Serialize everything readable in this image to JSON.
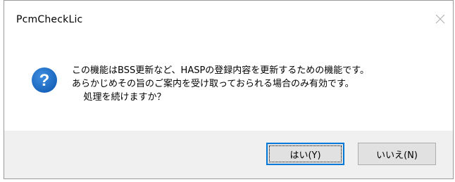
{
  "window": {
    "title": "PcmCheckLic",
    "close_icon": "close-icon"
  },
  "dialog": {
    "icon": "question-icon",
    "icon_color": "#1e6fc6",
    "message": "この機能はBSS更新など、HASPの登録内容を更新するための機能です。\nあらかじめその旨のご案内を受け取っておられる場合のみ有効です。\n    処理を続けますか？"
  },
  "buttons": {
    "yes_label": "はい(Y)",
    "no_label": "いいえ(N)",
    "accent": "#0078d7"
  }
}
